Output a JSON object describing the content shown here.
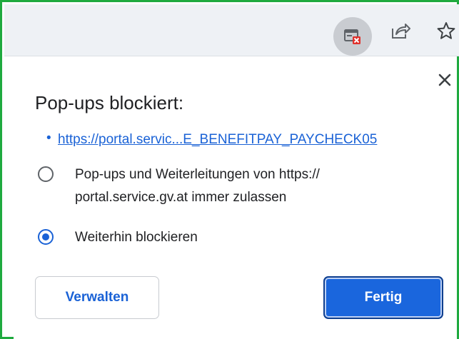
{
  "toolbar": {
    "icons": [
      "popup-blocked-icon",
      "share-icon",
      "star-icon"
    ]
  },
  "popup": {
    "title": "Pop-ups blockiert:",
    "blocked_item_bullet": "•",
    "blocked_url": "https://portal.servic...E_BENEFITPAY_PAYCHECK05",
    "options": [
      {
        "label": "Pop-ups und Weiterleitungen von https:// portal.service.gv.at immer zulassen",
        "checked": false
      },
      {
        "label": "Weiterhin blockieren",
        "checked": true
      }
    ],
    "manage_label": "Verwalten",
    "done_label": "Fertig",
    "close_symbol": "✕"
  },
  "colors": {
    "accent": "#1a62d6",
    "frame_border": "#1faa3f",
    "toolbar_bg": "#eef1f5"
  }
}
